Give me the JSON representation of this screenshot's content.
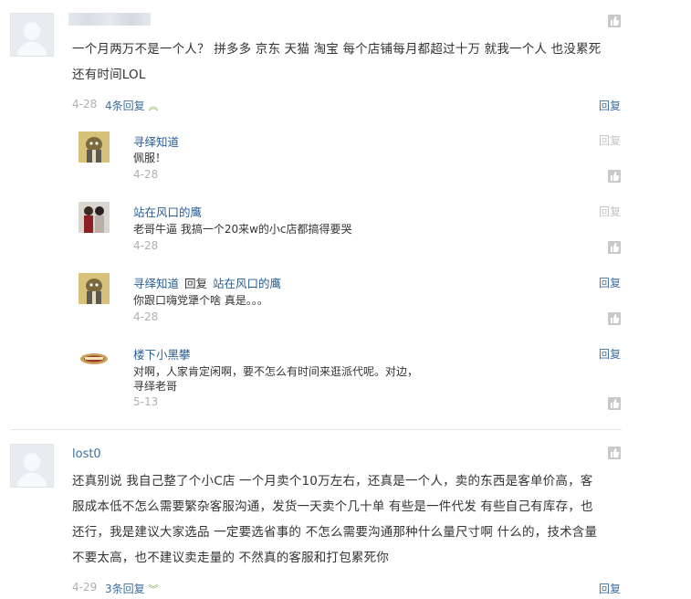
{
  "comments": [
    {
      "user": "",
      "content_line1": "一个月两万不是一个人？  拼多多  京东  天猫  淘宝  每个店铺每月都超过十万  就我一个人  也没累死",
      "content_line2": "还有时间LOL",
      "date": "4-28",
      "replies_count": "4条回复",
      "reply_label": "回复",
      "sub_replies": [
        {
          "user": "寻绎知道",
          "reply_word": "",
          "target": "",
          "text": "佩服！",
          "date": "4-28",
          "reply_label": "回复"
        },
        {
          "user": "站在风口的鹰",
          "reply_word": "",
          "target": "",
          "text": "老哥牛逼  我搞一个20来w的小c店都搞得要哭",
          "date": "4-28",
          "reply_label": "回复"
        },
        {
          "user": "寻绎知道",
          "reply_word": "回复",
          "target": "站在风口的鹰",
          "text": "你跟口嗨党犟个啥  真是。。。",
          "date": "4-28",
          "reply_label": "回复"
        },
        {
          "user": "楼下小黑攀",
          "reply_word": "",
          "target": "",
          "text_line1": "对啊，人家肯定闲啊，要不怎么有时间来逛派代呢。对边，",
          "text_line2": "寻绎老哥",
          "date": "5-13",
          "reply_label": "回复"
        }
      ]
    },
    {
      "user": "lost0",
      "content_lines": [
        "还真别说  我自己整了个小C店  一个月卖个10万左右，还真是一个人，卖的东西是客单价高，客",
        "服成本低不怎么需要繁杂客服沟通，发货一天卖个几十单  有些是一件代发 有些自己有库存，也",
        "还行，我是建议大家选品 一定要选省事的 不怎么需要沟通那种什么量尺寸啊  什么的，技术含量",
        "不要太高，也不建议卖走量的  不然真的客服和打包累死你"
      ],
      "date": "4-29",
      "replies_count": "3条回复",
      "reply_label": "回复"
    }
  ],
  "icons": {
    "like": "thumbs-up-icon",
    "expand": "double-chevron-up-icon",
    "avatar": "default-user-avatar-icon"
  },
  "colors": {
    "link": "#3f6f9f",
    "name": "#2a5d94",
    "muted": "#b0b0b0",
    "chevron": "#7aa84a"
  }
}
